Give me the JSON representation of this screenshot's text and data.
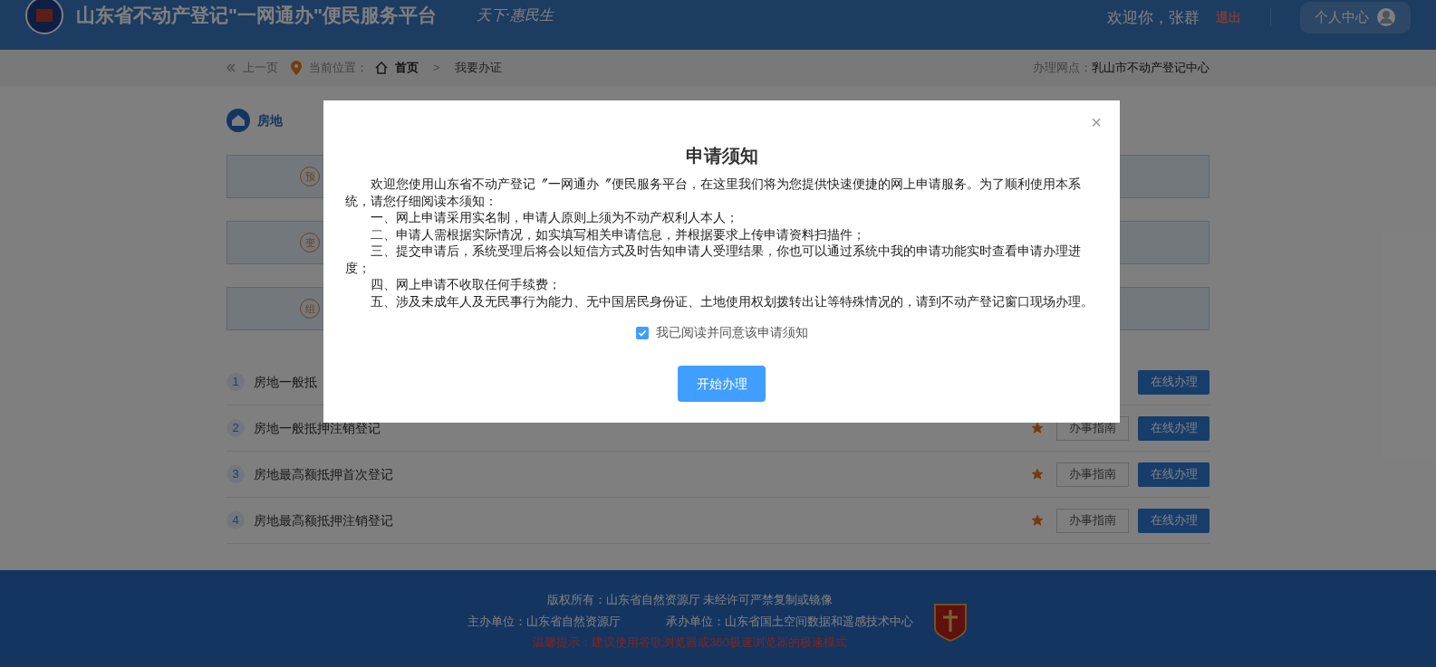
{
  "header": {
    "title": "山东省不动产登记\"一网通办\"便民服务平台",
    "slogan": "天下·惠民生",
    "welcome": "欢迎你，张群",
    "logout": "退出",
    "user_center": "个人中心"
  },
  "breadcrumb": {
    "back": "上一页",
    "location_label": "当前位置：",
    "home": "首页",
    "separator": ">",
    "current": "我要办证",
    "office_label": "办理网点：",
    "office": "乳山市不动产登记中心"
  },
  "category_tab": {
    "label": "房地",
    "selected": true
  },
  "cards": [
    {
      "glyph": "预"
    },
    {
      "glyph": "变"
    },
    {
      "glyph": "组"
    }
  ],
  "items": [
    {
      "number": "1",
      "name": "房地一般抵",
      "apply": "在线办理"
    },
    {
      "number": "2",
      "name": "房地一般抵押注销登记",
      "starred": true,
      "guide": "办事指南",
      "apply": "在线办理"
    },
    {
      "number": "3",
      "name": "房地最高额抵押首次登记",
      "starred": true,
      "guide": "办事指南",
      "apply": "在线办理"
    },
    {
      "number": "4",
      "name": "房地最高额抵押注销登记",
      "starred": true,
      "guide": "办事指南",
      "apply": "在线办理"
    }
  ],
  "footer": {
    "copyright": "版权所有：山东省自然资源厅 未经许可严禁复制或镜像",
    "host": "主办单位：山东省自然资源厅",
    "organizer": "承办单位：山东省国土空间数据和遥感技术中心",
    "tip": "温馨提示：建议使用谷歌浏览器或360极速浏览器的极速模式"
  },
  "dialog": {
    "title": "申请须知",
    "close": "×",
    "paragraphs": [
      "欢迎您使用山东省不动产登记〞一网通办〞便民服务平台，在这里我们将为您提供快速便捷的网上申请服务。为了顺利使用本系统，请您仔细阅读本须知：",
      "一、网上申请采用实名制，申请人原则上须为不动产权利人本人；",
      "二、申请人需根据实际情况，如实填写相关申请信息，并根据要求上传申请资料扫描件；",
      "三、提交申请后，系统受理后将会以短信方式及时告知申请人受理结果，你也可以通过系统中我的申请功能实时查看申请办理进度；",
      "四、网上申请不收取任何手续费；",
      "五、涉及未成年人及无民事行为能力、无中国居民身份证、土地使用权划拨转出让等特殊情况的，请到不动产登记窗口现场办理。"
    ],
    "agree": {
      "label": "我已阅读并同意该申请须知",
      "checked": true
    },
    "start": "开始办理"
  }
}
